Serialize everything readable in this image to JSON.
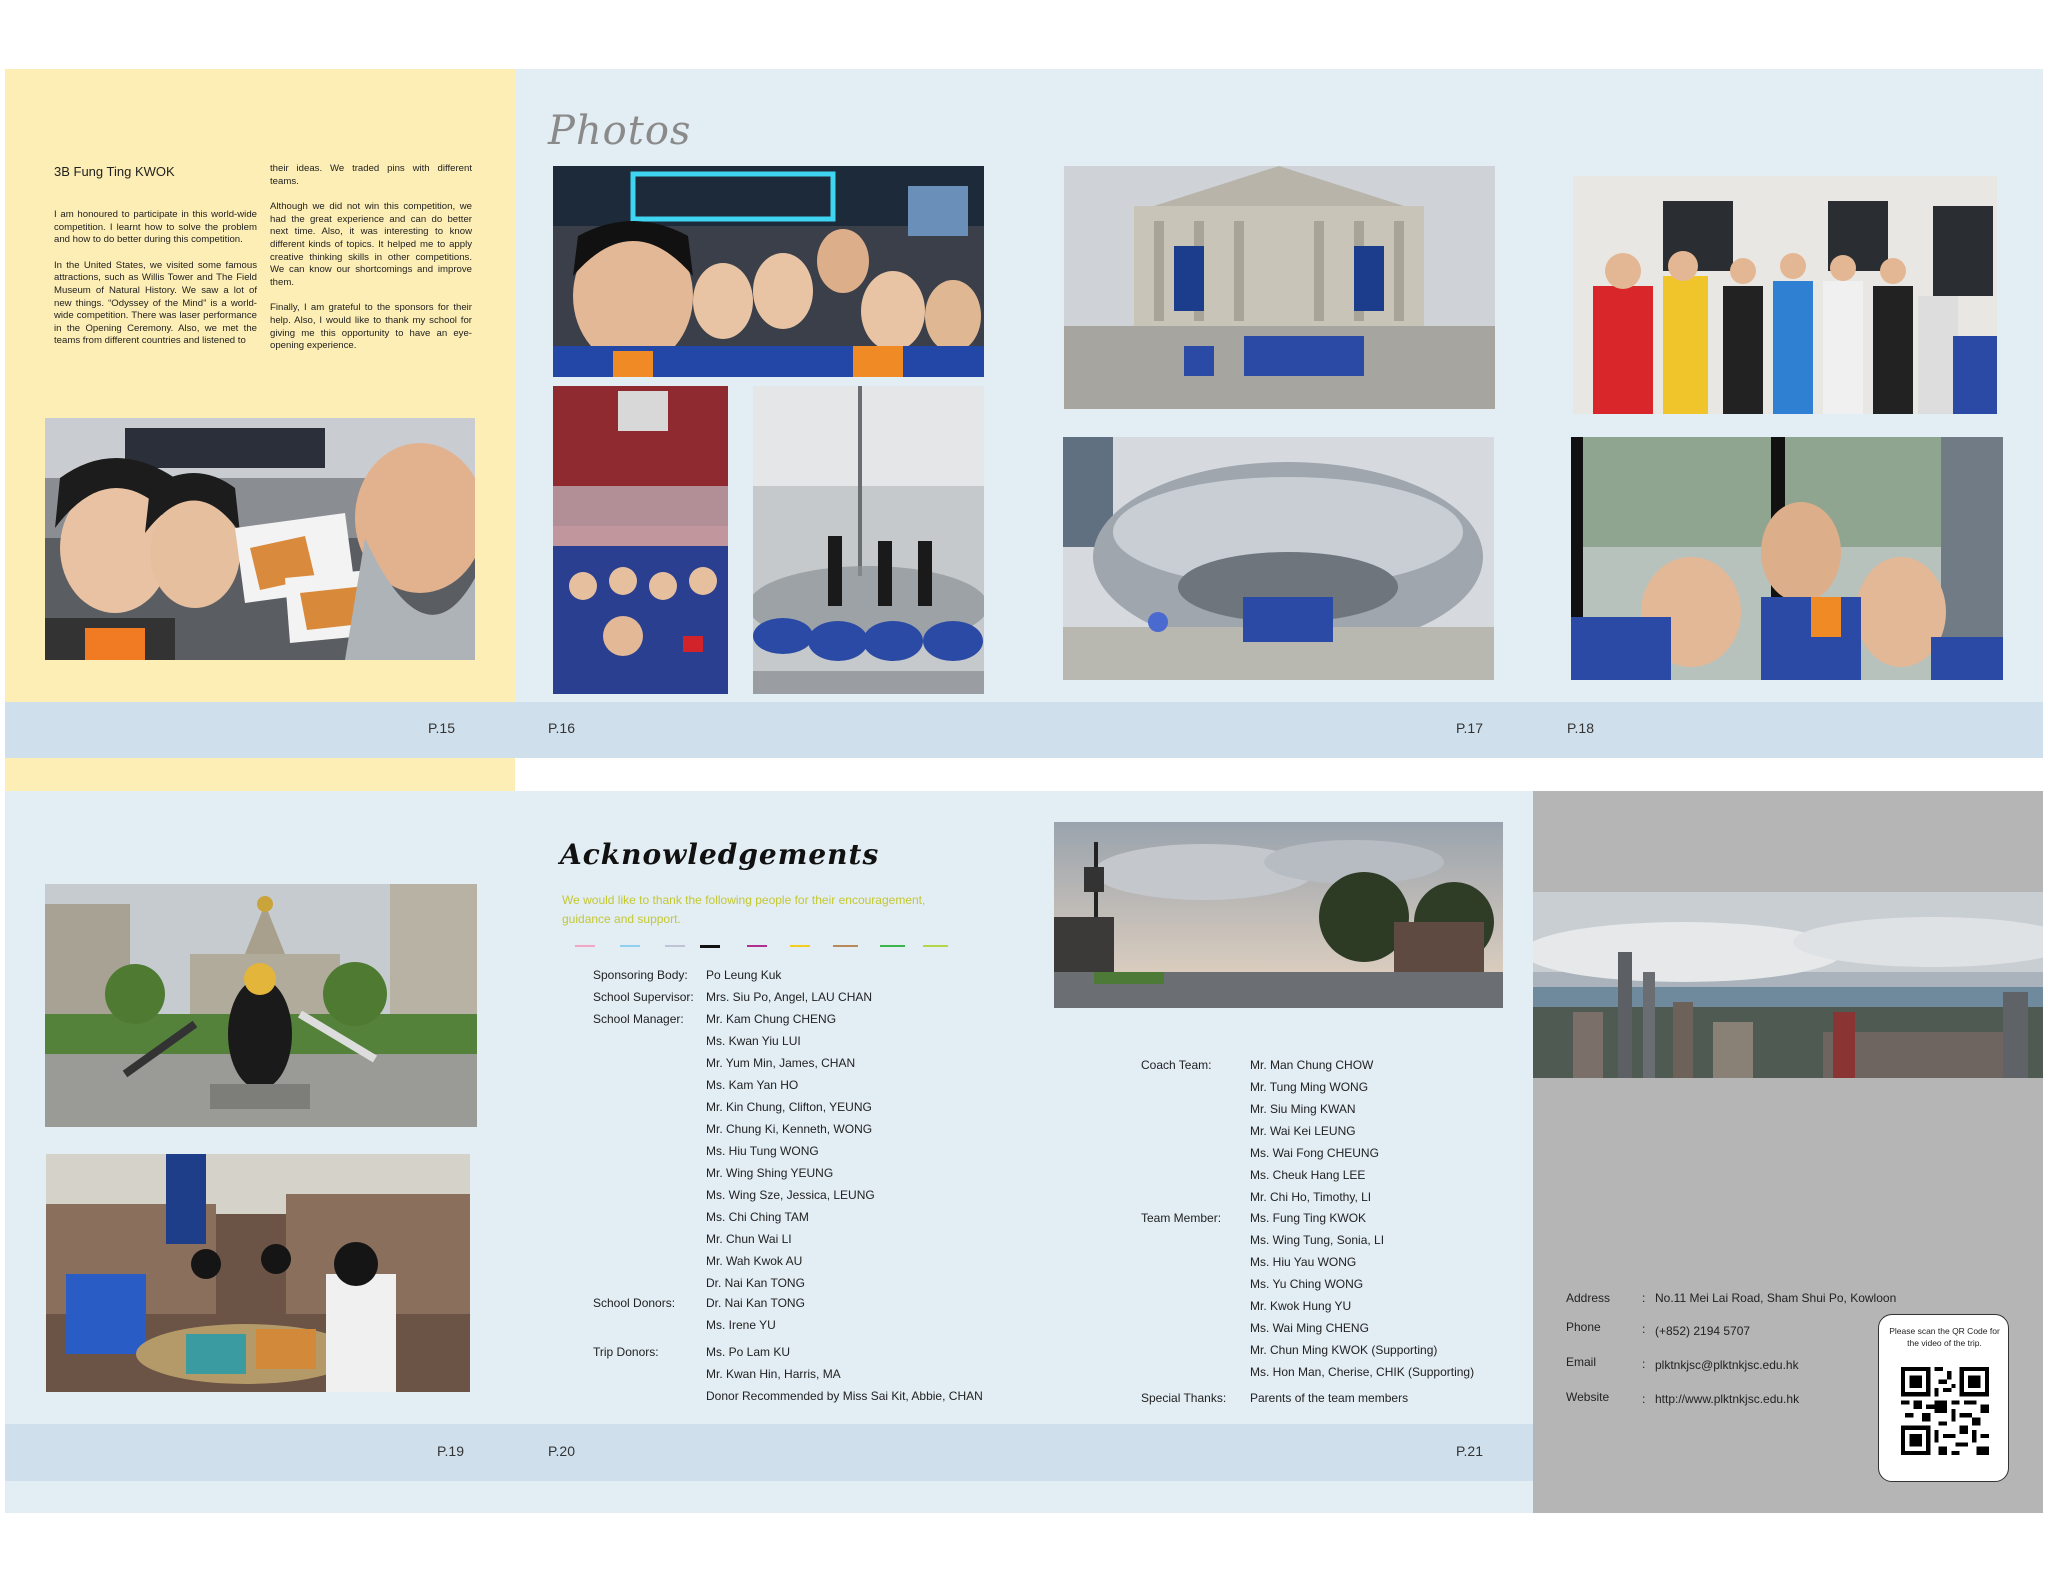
{
  "page15": {
    "author": "3B Fung Ting KWOK",
    "col1": [
      "I am honoured to participate in this world-wide competition. I learnt how to solve the problem and how to do better during this competition.",
      "In the United States, we visited some famous attractions, such as Willis Tower and The Field Museum of Natural History. We saw a lot of new things. “Odyssey of the Mind” is a world-wide competition. There was laser performance in the Opening Ceremony. Also, we met the teams from different countries and listened to"
    ],
    "col2": [
      "their ideas. We traded pins with different teams.",
      "Although we did not win this competition, we had the great experience and can do better next time. Also, it was interesting to know different kinds of topics. It helped me to apply creative thinking skills in other competitions. We can know our shortcomings and improve them.",
      "Finally, I am grateful to the sponsors for their help. Also, I would like to thank my school for giving me this opportunity to have an eye-opening experience."
    ],
    "page_number": "P.15"
  },
  "page16": {
    "title": "Photos",
    "page_number": "P.16"
  },
  "page17": {
    "page_number": "P.17"
  },
  "page18": {
    "page_number": "P.18"
  },
  "page19": {
    "page_number": "P.19"
  },
  "page20": {
    "title": "Acknowledgements",
    "intro": "We would like to thank the following people for their encouragement, guidance and support.",
    "divider_colors": [
      "#f2a6c4",
      "#8fd0ee",
      "#bfc3d6",
      "#111111",
      "#b0308f",
      "#f2cc1e",
      "#b88a58",
      "#3cb54a",
      "#b6d64a"
    ],
    "sponsoring_body_label": "Sponsoring Body:",
    "sponsoring_body": "Po Leung Kuk",
    "school_supervisor_label": "School Supervisor:",
    "school_supervisor": "Mrs. Siu Po, Angel, LAU CHAN",
    "school_manager_label": "School Manager:",
    "school_managers": [
      "Mr. Kam Chung CHENG",
      "Ms. Kwan Yiu LUI",
      "Mr. Yum Min, James, CHAN",
      "Ms. Kam Yan HO",
      "Mr. Kin Chung, Clifton, YEUNG",
      "Mr. Chung Ki, Kenneth, WONG",
      "Ms. Hiu Tung WONG",
      "Mr. Wing Shing YEUNG",
      "Ms. Wing Sze, Jessica, LEUNG",
      "Ms. Chi Ching TAM",
      "Mr. Chun Wai LI",
      "Mr. Wah Kwok AU",
      "Dr. Nai Kan TONG"
    ],
    "school_donors_label": "School Donors:",
    "school_donors": [
      "Dr. Nai Kan TONG",
      "Ms. Irene YU"
    ],
    "trip_donors_label": "Trip Donors:",
    "trip_donors": [
      "Ms. Po Lam KU",
      "Mr. Kwan Hin, Harris, MA",
      "Donor Recommended by Miss Sai Kit, Abbie, CHAN"
    ],
    "page_number": "P.20"
  },
  "page21": {
    "coach_team_label": "Coach Team:",
    "coach_team": [
      "Mr. Man Chung CHOW",
      "Mr. Tung Ming WONG",
      "Mr. Siu Ming KWAN",
      "Mr. Wai Kei LEUNG",
      "Ms. Wai Fong CHEUNG",
      "Ms. Cheuk Hang LEE",
      "Mr. Chi Ho, Timothy, LI"
    ],
    "team_member_label": "Team Member:",
    "team_members": [
      "Ms. Fung Ting KWOK",
      "Ms. Wing Tung, Sonia, LI",
      "Ms. Hiu Yau WONG",
      "Ms. Yu Ching WONG",
      "Mr. Kwok Hung YU",
      "Ms. Wai Ming CHENG",
      "Mr. Chun Ming KWOK (Supporting)",
      "Ms. Hon Man, Cherise, CHIK (Supporting)"
    ],
    "special_thanks_label": "Special Thanks:",
    "special_thanks": "Parents of the team members",
    "page_number": "P.21"
  },
  "back_cover": {
    "address_label": "Address",
    "address": "No.11 Mei Lai Road, Sham Shui Po, Kowloon",
    "phone_label": "Phone",
    "phone": "(+852) 2194 5707",
    "email_label": "Email",
    "email": "plktnkjsc@plktnkjsc.edu.hk",
    "website_label": "Website",
    "website": "http://www.plktnkjsc.edu.hk",
    "separator": ":",
    "qr_caption": "Please scan the QR Code for the video of the trip."
  },
  "colors": {
    "light_blue": "#e3edf4",
    "footer_blue": "#cfe0ec",
    "yellow": "#fdeeb5",
    "grey": "#b5b5b5",
    "ack_intro": "#c3c832"
  }
}
